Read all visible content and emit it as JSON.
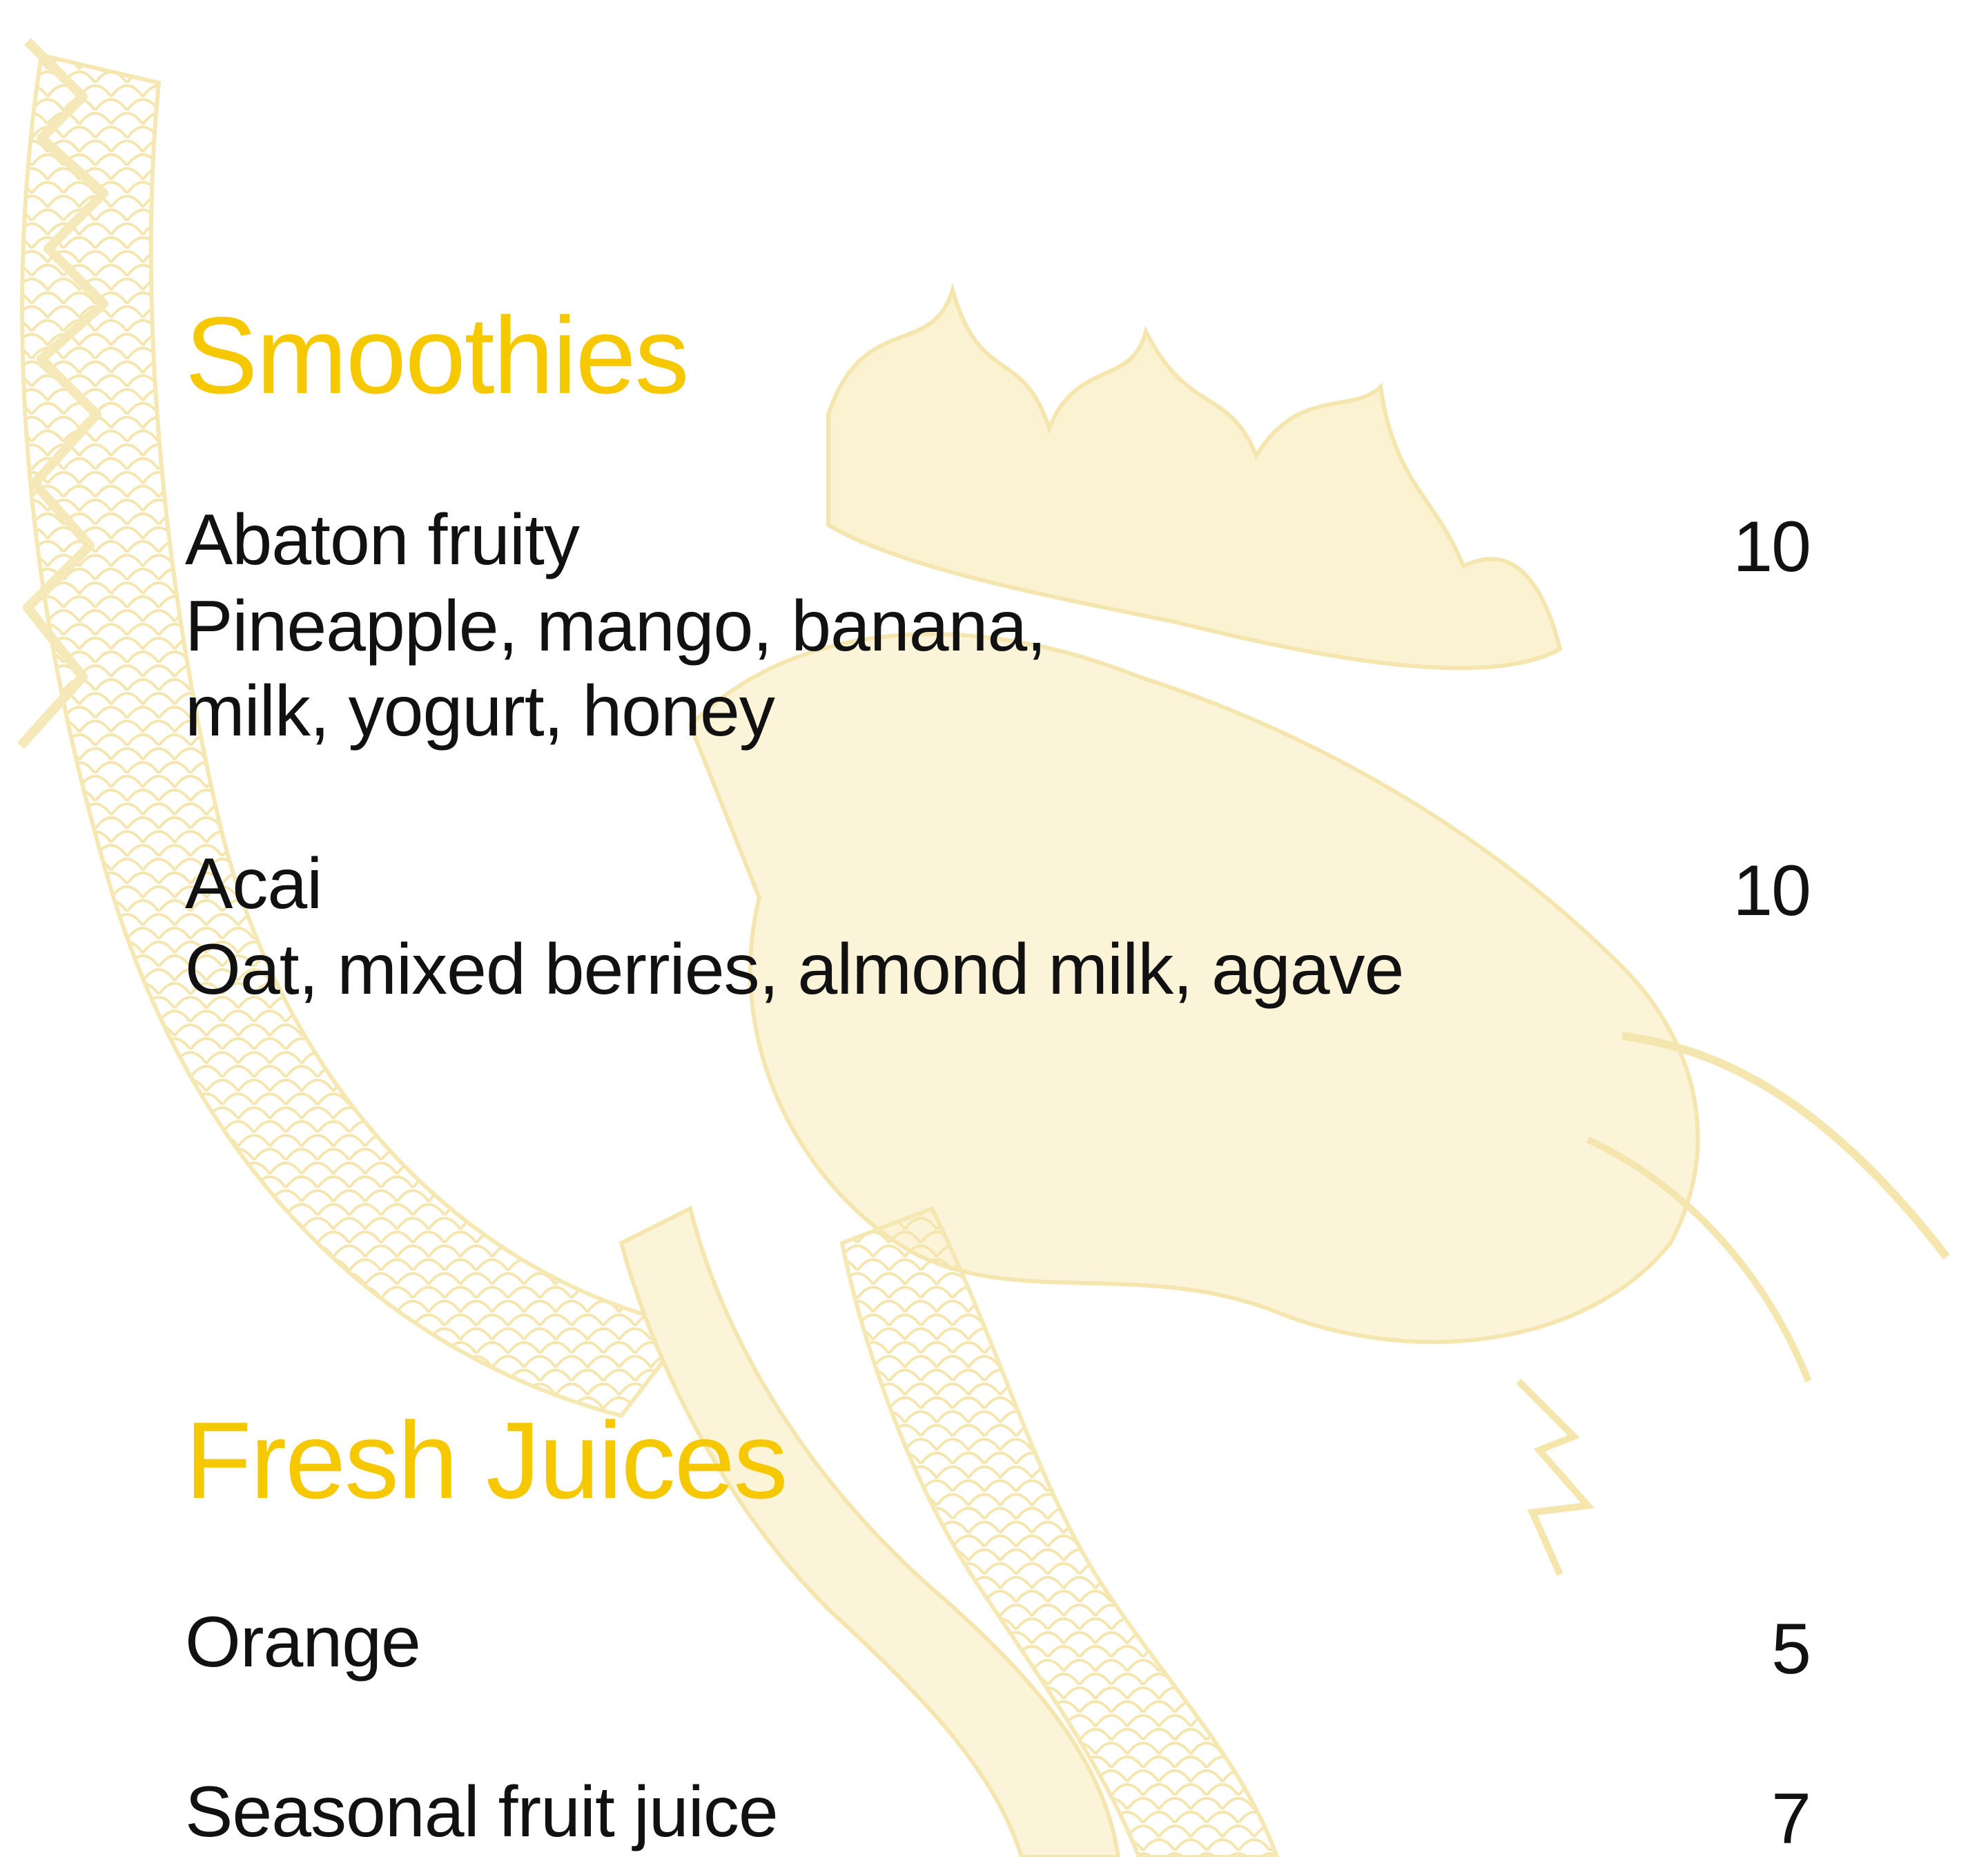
{
  "watermark": {
    "icon": "dragon-illustration",
    "color": "#f7e6a3"
  },
  "accent_color": "#f5c800",
  "sections": [
    {
      "title": "Smoothies",
      "items": [
        {
          "name": "Abaton fruity",
          "description_lines": [
            "Pineapple, mango, banana,",
            "milk, yogurt, honey"
          ],
          "price": "10"
        },
        {
          "name": "Acai",
          "description_lines": [
            "Oat, mixed berries, almond milk, agave"
          ],
          "price": "10"
        }
      ]
    },
    {
      "title": "Fresh Juices",
      "items": [
        {
          "name": "Orange",
          "price": "5"
        },
        {
          "name": "Seasonal fruit juice",
          "price": "7"
        }
      ]
    }
  ]
}
